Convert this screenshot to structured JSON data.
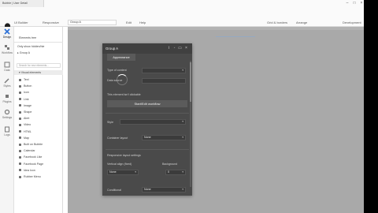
{
  "titlebar": {
    "tab_label": "Bubble | User Detail",
    "minimize": "–",
    "maximize": "□",
    "close": "×"
  },
  "toolbar": {
    "mode_ui": "UI Builder",
    "mode_responsive": "Responsive",
    "page_selector": "Group A",
    "edit": "Edit",
    "help": "Help",
    "guides": "Grid & borders",
    "arrange": "Arrange",
    "environment": "Development"
  },
  "rail": {
    "items": [
      {
        "label": "Design"
      },
      {
        "label": "Workflow"
      },
      {
        "label": "Data"
      },
      {
        "label": "Styles"
      },
      {
        "label": "Plugins"
      },
      {
        "label": "Settings"
      },
      {
        "label": "Logs"
      }
    ]
  },
  "tree": {
    "header_label": "Elements tree",
    "only_visible": "Only show hidden/hie",
    "root_item": "▸ Group A",
    "search_placeholder": "Search for new elements...",
    "section_visual": "▾ Visual elements",
    "elements": [
      "Text",
      "Button",
      "Icon",
      "Link",
      "Image",
      "Shape",
      "Alert",
      "Video",
      "HTML",
      "Map",
      "Built on Bubble",
      "Calendar",
      "Facebook Like",
      "Facebook Page",
      "Idea Icon",
      "Rubber Menu"
    ]
  },
  "editor": {
    "title": "Group A",
    "tab_appearance": "Appearance",
    "type_of_content": "Type of content",
    "data_source": "Data source",
    "element_actions": "This element isn't clickable",
    "start_edit_workflow": "Start/Edit workflow",
    "style_label": "Style",
    "style_value": "",
    "container_layout": "Container layout",
    "container_layout_value": "None",
    "responsive_section": "Responsive layout settings",
    "vertical_align_label": "Vertical align (fixed)",
    "bg_label": "Background",
    "bg_value": "None",
    "bg_opacity": "0",
    "conditional": "Conditional",
    "conditional_value": "None"
  }
}
